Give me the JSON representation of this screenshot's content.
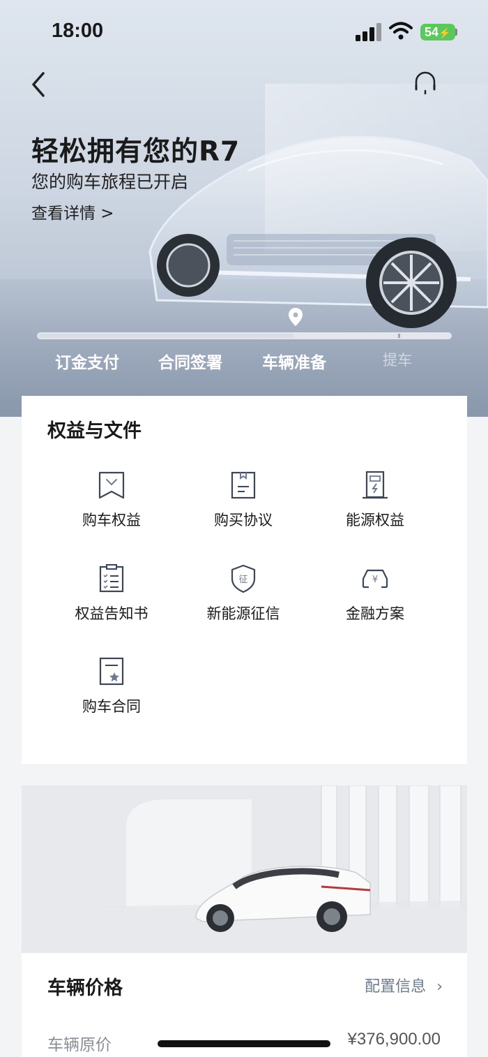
{
  "status_bar": {
    "time": "18:00",
    "battery": "54"
  },
  "hero": {
    "title": "轻松拥有您的R7",
    "subtitle": "您的购车旅程已开启",
    "details_link": "查看详情 >"
  },
  "progress": {
    "level": 0.62,
    "steps": [
      {
        "label": "订金支付",
        "done": true
      },
      {
        "label": "合同签署",
        "done": true
      },
      {
        "label": "车辆准备",
        "done": true
      },
      {
        "label": "提车",
        "done": false
      }
    ]
  },
  "benefits": {
    "title": "权益与文件",
    "items": [
      {
        "label": "购车权益",
        "icon": "bookmark-icon"
      },
      {
        "label": "购买协议",
        "icon": "agreement-doc-icon"
      },
      {
        "label": "能源权益",
        "icon": "charging-pile-icon"
      },
      {
        "label": "权益告知书",
        "icon": "checklist-icon"
      },
      {
        "label": "新能源征信",
        "icon": "shield-credit-icon"
      },
      {
        "label": "金融方案",
        "icon": "car-yuan-icon"
      },
      {
        "label": "购车合同",
        "icon": "contract-star-icon"
      }
    ]
  },
  "vehicle_price": {
    "title": "车辆价格",
    "config_link": "配置信息",
    "original_price_label": "车辆原价",
    "original_price_value": "¥376,900.00"
  },
  "colors": {
    "accent_link": "#6d7b8e",
    "icon_stroke": "#3d4654",
    "battery_green": "#5ac85a"
  }
}
